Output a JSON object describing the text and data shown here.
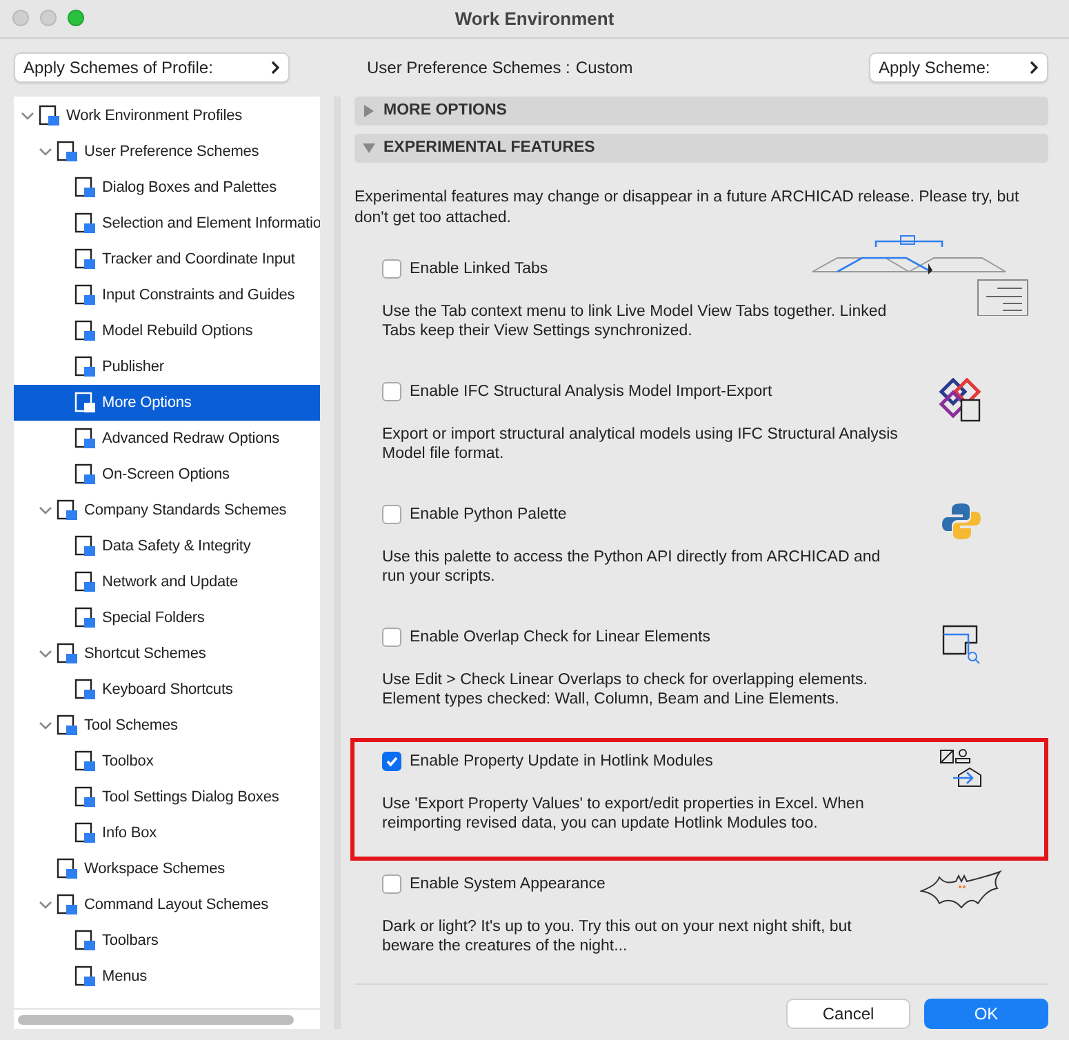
{
  "window": {
    "title": "Work Environment"
  },
  "toolbar": {
    "profile_button": "Apply Schemes of Profile:",
    "scheme_label": "User Preference Schemes :",
    "scheme_value": "Custom",
    "apply_button": "Apply Scheme:"
  },
  "tree": [
    {
      "label": "Work Environment Profiles",
      "expanded": true,
      "selected": false,
      "children": [
        {
          "label": "User Preference Schemes",
          "expanded": true,
          "selected": false,
          "children": [
            {
              "label": "Dialog Boxes and Palettes",
              "selected": false
            },
            {
              "label": "Selection and Element Informatio",
              "selected": false
            },
            {
              "label": "Tracker and Coordinate Input",
              "selected": false
            },
            {
              "label": "Input Constraints and Guides",
              "selected": false
            },
            {
              "label": "Model Rebuild Options",
              "selected": false
            },
            {
              "label": "Publisher",
              "selected": false
            },
            {
              "label": "More Options",
              "selected": true
            },
            {
              "label": "Advanced Redraw Options",
              "selected": false
            },
            {
              "label": "On-Screen Options",
              "selected": false
            }
          ]
        },
        {
          "label": "Company Standards Schemes",
          "expanded": true,
          "selected": false,
          "children": [
            {
              "label": "Data Safety & Integrity",
              "selected": false
            },
            {
              "label": "Network and Update",
              "selected": false
            },
            {
              "label": "Special Folders",
              "selected": false
            }
          ]
        },
        {
          "label": "Shortcut Schemes",
          "expanded": true,
          "selected": false,
          "children": [
            {
              "label": "Keyboard Shortcuts",
              "selected": false
            }
          ]
        },
        {
          "label": "Tool Schemes",
          "expanded": true,
          "selected": false,
          "children": [
            {
              "label": "Toolbox",
              "selected": false
            },
            {
              "label": "Tool Settings Dialog Boxes",
              "selected": false
            },
            {
              "label": "Info Box",
              "selected": false
            }
          ]
        },
        {
          "label": "Workspace Schemes",
          "selected": false
        },
        {
          "label": "Command Layout Schemes",
          "expanded": true,
          "selected": false,
          "children": [
            {
              "label": "Toolbars",
              "selected": false
            },
            {
              "label": "Menus",
              "selected": false
            }
          ]
        }
      ]
    }
  ],
  "sections": [
    {
      "title": "MORE OPTIONS",
      "expanded": false
    },
    {
      "title": "EXPERIMENTAL FEATURES",
      "expanded": true
    }
  ],
  "intro": "Experimental features may change or disappear in a future ARCHICAD release. Please try, but don't get too attached.",
  "features": [
    {
      "label": "Enable Linked Tabs",
      "checked": false,
      "highlighted": false,
      "description": "Use the Tab context menu to link Live Model View Tabs together. Linked Tabs keep their View Settings synchronized."
    },
    {
      "label": "Enable IFC Structural Analysis Model Import-Export",
      "checked": false,
      "highlighted": false,
      "description": "Export or import structural analytical models using IFC Structural Analysis Model file format."
    },
    {
      "label": "Enable Python Palette",
      "checked": false,
      "highlighted": false,
      "description": "Use this palette to access the Python API directly from ARCHICAD and run your scripts."
    },
    {
      "label": "Enable Overlap Check for Linear Elements",
      "checked": false,
      "highlighted": false,
      "description": "Use Edit > Check Linear Overlaps to check for overlapping elements. Element types checked: Wall, Column, Beam and Line Elements."
    },
    {
      "label": "Enable Property Update in Hotlink Modules",
      "checked": true,
      "highlighted": true,
      "description": "Use 'Export Property Values' to export/edit properties in Excel. When reimporting revised data, you can update Hotlink Modules too."
    },
    {
      "label": "Enable System Appearance",
      "checked": false,
      "highlighted": false,
      "description": "Dark or light? It's up to you. Try this out on your next night shift, but beware the creatures of the night..."
    }
  ],
  "buttons": [
    {
      "label": "Cancel",
      "default": false
    },
    {
      "label": "OK",
      "default": true
    }
  ]
}
